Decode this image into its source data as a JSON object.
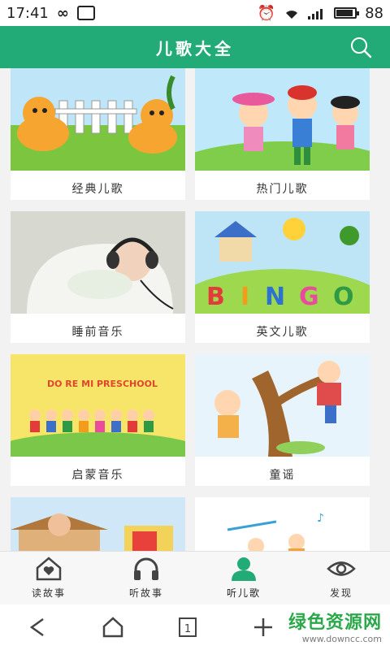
{
  "status_bar": {
    "time": "17:41",
    "battery": "88"
  },
  "app_bar": {
    "title": "儿歌大全"
  },
  "categories": [
    {
      "label": "经典儿歌"
    },
    {
      "label": "热门儿歌"
    },
    {
      "label": "睡前音乐"
    },
    {
      "label": "英文儿歌"
    },
    {
      "label": "启蒙音乐"
    },
    {
      "label": "童谣"
    }
  ],
  "bingo_letters": [
    "B",
    "I",
    "N",
    "G",
    "O"
  ],
  "preschool_text": "DO RE MI PRESCHOOL",
  "bottom_nav": [
    {
      "label": "读故事",
      "icon": "house-heart-icon"
    },
    {
      "label": "听故事",
      "icon": "headphones-icon"
    },
    {
      "label": "听儿歌",
      "icon": "person-icon"
    },
    {
      "label": "发现",
      "icon": "eye-icon"
    }
  ],
  "system_nav": {
    "tab_count": "1"
  },
  "watermark": {
    "main": "绿色资源网",
    "sub": "www.downcc.com"
  },
  "colors": {
    "primary": "#22ab76",
    "background": "#f2f2f2"
  }
}
